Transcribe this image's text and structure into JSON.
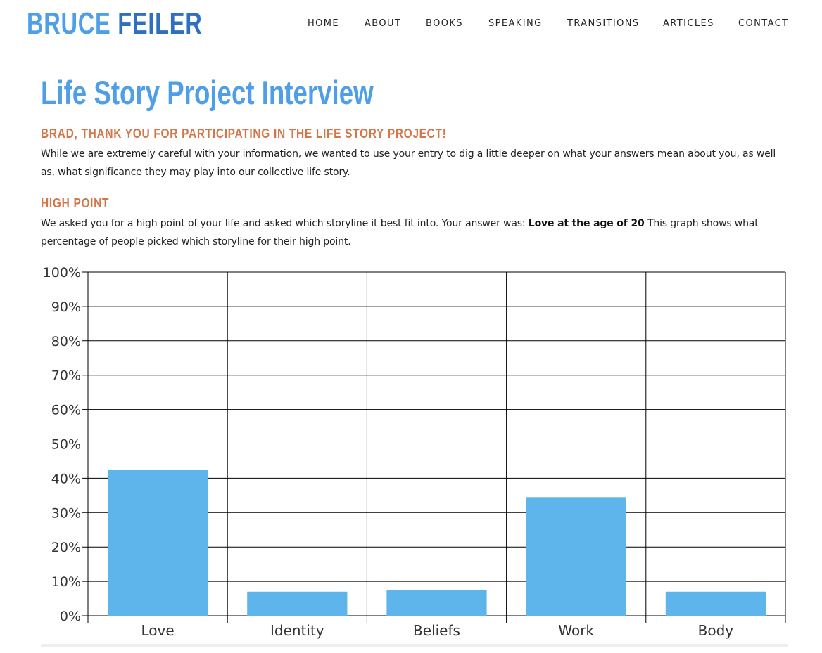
{
  "header": {
    "logo_first": "BRUCE",
    "logo_last": "FEILER",
    "nav": [
      "HOME",
      "ABOUT",
      "BOOKS",
      "SPEAKING",
      "TRANSITIONS",
      "ARTICLES",
      "CONTACT"
    ]
  },
  "content": {
    "title": "Life Story Project Interview",
    "thanks_heading": "BRAD, THANK YOU FOR PARTICIPATING IN THE LIFE STORY PROJECT!",
    "intro": "While we are extremely careful with your information, we wanted to use your entry to dig a little deeper on what your answers mean about you, as well as, what significance they may play into our collective life story.",
    "high_point_heading": "HIGH POINT",
    "high_point_text_before": "We asked you for a high point of your life and asked which storyline it best fit into. Your answer was: ",
    "high_point_answer": "Love at the age of 20",
    "high_point_text_after": " This graph shows what percentage of people picked which storyline for their high point."
  },
  "colors": {
    "logo_light": "#4f9fe8",
    "logo_dark": "#2f6fc2",
    "heading_orange": "#d3764a",
    "bar": "#5db5eb"
  },
  "chart_data": {
    "type": "bar",
    "categories": [
      "Love",
      "Identity",
      "Beliefs",
      "Work",
      "Body"
    ],
    "values": [
      42.5,
      7,
      7.5,
      34.5,
      7
    ],
    "ylim": [
      0,
      100
    ],
    "yticks": [
      "0%",
      "10%",
      "20%",
      "30%",
      "40%",
      "50%",
      "60%",
      "70%",
      "80%",
      "90%",
      "100%"
    ],
    "grid": true,
    "legend": "none"
  }
}
